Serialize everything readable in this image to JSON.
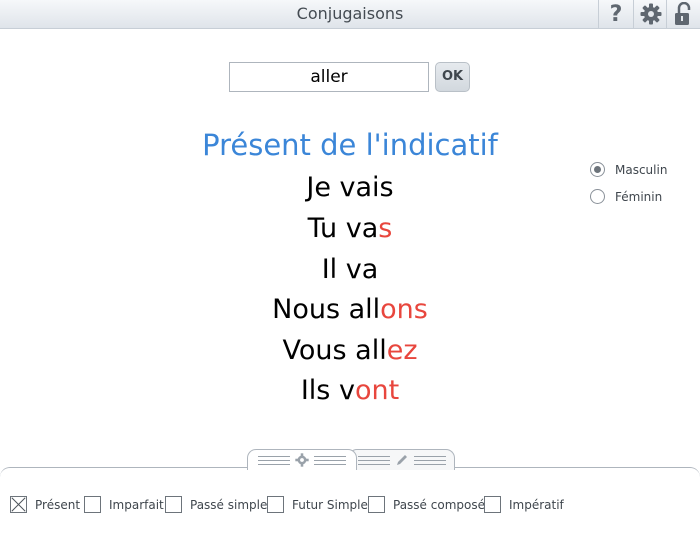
{
  "window": {
    "title": "Conjugaisons"
  },
  "toolbar": {
    "help_label": "?"
  },
  "search": {
    "value": "aller",
    "ok_label": "OK"
  },
  "tense_heading": "Présent de l'indicatif",
  "conjugations": [
    {
      "stem": "Je vais",
      "ending": ""
    },
    {
      "stem": "Tu va",
      "ending": "s"
    },
    {
      "stem": "Il va",
      "ending": ""
    },
    {
      "stem": "Nous all",
      "ending": "ons"
    },
    {
      "stem": "Vous all",
      "ending": "ez"
    },
    {
      "stem": "Ils v",
      "ending": "ont"
    }
  ],
  "gender": {
    "options": [
      {
        "label": "Masculin",
        "selected": true
      },
      {
        "label": "Féminin",
        "selected": false
      }
    ]
  },
  "tenses": [
    {
      "label": "Présent",
      "checked": true
    },
    {
      "label": "Imparfait",
      "checked": false
    },
    {
      "label": "Passé simple",
      "checked": false
    },
    {
      "label": "Futur Simple",
      "checked": false
    },
    {
      "label": "Passé composé",
      "checked": false
    },
    {
      "label": "Impératif",
      "checked": false
    }
  ],
  "colors": {
    "heading": "#3b86d8",
    "ending": "#e8463d"
  }
}
